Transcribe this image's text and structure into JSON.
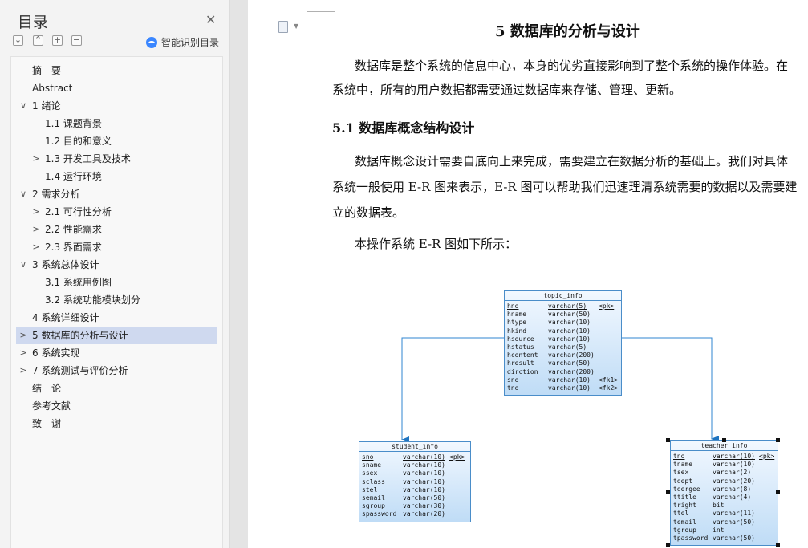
{
  "sidebar": {
    "title": "目录",
    "smart_toc_label": "智能识别目录",
    "items": [
      {
        "label": "摘　要",
        "level": 1,
        "chevron": ""
      },
      {
        "label": "Abstract",
        "level": 1,
        "chevron": ""
      },
      {
        "label": "1 绪论",
        "level": 1,
        "chevron": "expanded"
      },
      {
        "label": "1.1 课题背景",
        "level": 2,
        "chevron": ""
      },
      {
        "label": "1.2 目的和意义",
        "level": 2,
        "chevron": ""
      },
      {
        "label": "1.3 开发工具及技术",
        "level": 2,
        "chevron": "collapsed"
      },
      {
        "label": "1.4 运行环境",
        "level": 2,
        "chevron": ""
      },
      {
        "label": "2  需求分析",
        "level": 1,
        "chevron": "expanded"
      },
      {
        "label": "2.1 可行性分析",
        "level": 2,
        "chevron": "collapsed"
      },
      {
        "label": "2.2 性能需求",
        "level": 2,
        "chevron": "collapsed"
      },
      {
        "label": "2.3 界面需求",
        "level": 2,
        "chevron": "collapsed"
      },
      {
        "label": "3  系统总体设计",
        "level": 1,
        "chevron": "expanded"
      },
      {
        "label": "3.1  系统用例图",
        "level": 2,
        "chevron": ""
      },
      {
        "label": "3.2  系统功能模块划分",
        "level": 2,
        "chevron": ""
      },
      {
        "label": "4 系统详细设计",
        "level": 1,
        "chevron": ""
      },
      {
        "label": "5 数据库的分析与设计",
        "level": 1,
        "chevron": "collapsed",
        "active": true
      },
      {
        "label": "6 系统实现",
        "level": 1,
        "chevron": "collapsed"
      },
      {
        "label": "7 系统测试与评价分析",
        "level": 1,
        "chevron": "collapsed"
      },
      {
        "label": "结　论",
        "level": 1,
        "chevron": ""
      },
      {
        "label": "参考文献",
        "level": 1,
        "chevron": ""
      },
      {
        "label": "致　谢",
        "level": 1,
        "chevron": ""
      }
    ]
  },
  "document": {
    "heading": "5 数据库的分析与设计",
    "para1_line1": "数据库是整个系统的信息中心，本身的优劣直接影响到了整个系统的操作体验。在",
    "para1_line2": "系统中，所有的用户数据都需要通过数据库来存储、管理、更新。",
    "subheading": "5.1 数据库概念结构设计",
    "para2_line1": "数据库概念设计需要自底向上来完成，需要建立在数据分析的基础上。我们对具体",
    "para2_line2": "系统一般使用 E-R 图来表示，E-R 图可以帮助我们迅速理清系统需要的数据以及需要建",
    "para2_line3": "立的数据表。",
    "para3": "本操作系统 E-R 图如下所示："
  },
  "er_diagram": {
    "tables": [
      {
        "name": "topic_info",
        "columns": [
          {
            "name": "hno",
            "type": "varchar(5)",
            "key": "<pk>"
          },
          {
            "name": "hname",
            "type": "varchar(50)",
            "key": ""
          },
          {
            "name": "htype",
            "type": "varchar(10)",
            "key": ""
          },
          {
            "name": "hkind",
            "type": "varchar(10)",
            "key": ""
          },
          {
            "name": "hsource",
            "type": "varchar(10)",
            "key": ""
          },
          {
            "name": "hstatus",
            "type": "varchar(5)",
            "key": ""
          },
          {
            "name": "hcontent",
            "type": "varchar(200)",
            "key": ""
          },
          {
            "name": "hresult",
            "type": "varchar(50)",
            "key": ""
          },
          {
            "name": "dirction",
            "type": "varchar(200)",
            "key": ""
          },
          {
            "name": "sno",
            "type": "varchar(10)",
            "key": "<fk1>"
          },
          {
            "name": "tno",
            "type": "varchar(10)",
            "key": "<fk2>"
          }
        ]
      },
      {
        "name": "student_info",
        "columns": [
          {
            "name": "sno",
            "type": "varchar(10)",
            "key": "<pk>"
          },
          {
            "name": "sname",
            "type": "varchar(10)",
            "key": ""
          },
          {
            "name": "ssex",
            "type": "varchar(10)",
            "key": ""
          },
          {
            "name": "sclass",
            "type": "varchar(10)",
            "key": ""
          },
          {
            "name": "stel",
            "type": "varchar(10)",
            "key": ""
          },
          {
            "name": "semail",
            "type": "varchar(50)",
            "key": ""
          },
          {
            "name": "sgroup",
            "type": "varchar(30)",
            "key": ""
          },
          {
            "name": "spassword",
            "type": "varchar(20)",
            "key": ""
          }
        ]
      },
      {
        "name": "teacher_info",
        "columns": [
          {
            "name": "tno",
            "type": "varchar(10)",
            "key": "<pk>"
          },
          {
            "name": "tname",
            "type": "varchar(10)",
            "key": ""
          },
          {
            "name": "tsex",
            "type": "varchar(2)",
            "key": ""
          },
          {
            "name": "tdept",
            "type": "varchar(20)",
            "key": ""
          },
          {
            "name": "tdergee",
            "type": "varchar(8)",
            "key": ""
          },
          {
            "name": "ttitle",
            "type": "varchar(4)",
            "key": ""
          },
          {
            "name": "tright",
            "type": "bit",
            "key": ""
          },
          {
            "name": "ttel",
            "type": "varchar(11)",
            "key": ""
          },
          {
            "name": "temail",
            "type": "varchar(50)",
            "key": ""
          },
          {
            "name": "tgroup",
            "type": "int",
            "key": ""
          },
          {
            "name": "tpassword",
            "type": "varchar(50)",
            "key": ""
          }
        ]
      }
    ]
  }
}
